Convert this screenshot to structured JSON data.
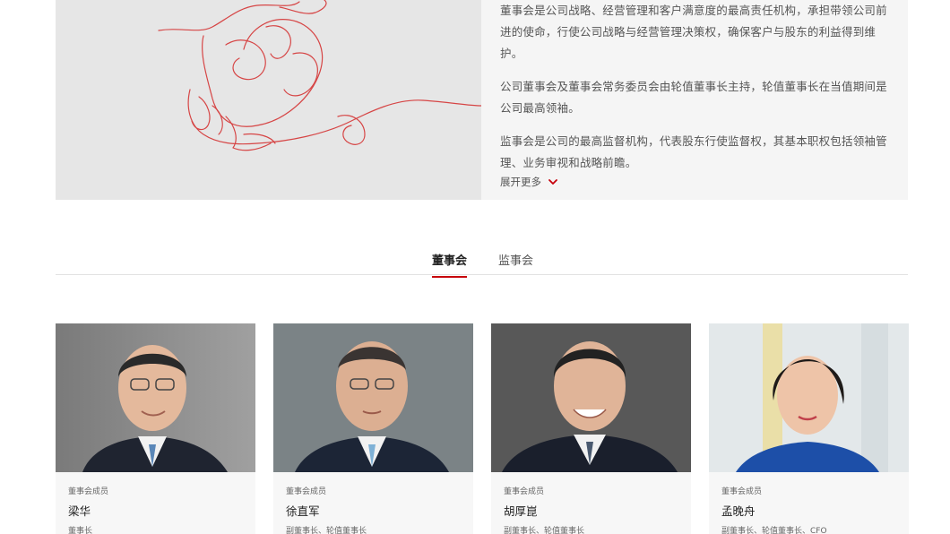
{
  "intro": {
    "paragraphs": [
      "董事会是公司战略、经营管理和客户满意度的最高责任机构，承担带领公司前进的使命，行使公司战略与经营管理决策权，确保客户与股东的利益得到维护。",
      "公司董事会及董事会常务委员会由轮值董事长主持，轮值董事长在当值期间是公司最高领袖。",
      "监事会是公司的最高监督机构，代表股东行使监督权，其基本职权包括领袖管理、业务审视和战略前瞻。"
    ],
    "expand_label": "展开更多"
  },
  "tabs": [
    {
      "label": "董事会",
      "active": true
    },
    {
      "label": "监事会",
      "active": false
    }
  ],
  "members": [
    {
      "category": "董事会成员",
      "name": "梁华",
      "title": "董事长",
      "bg": "#8e8e8e"
    },
    {
      "category": "董事会成员",
      "name": "徐直军",
      "title": "副董事长、轮值董事长",
      "bg": "#7d8588"
    },
    {
      "category": "董事会成员",
      "name": "胡厚崑",
      "title": "副董事长、轮值董事长",
      "bg": "#5d5d5d"
    },
    {
      "category": "董事会成员",
      "name": "孟晚舟",
      "title": "副董事长、轮值董事长、CFO",
      "bg": "#dfe4e6"
    }
  ],
  "colors": {
    "accent": "#c7000b",
    "line_art": "#d64545"
  },
  "icons": {
    "expand": "chevron-down-icon"
  }
}
